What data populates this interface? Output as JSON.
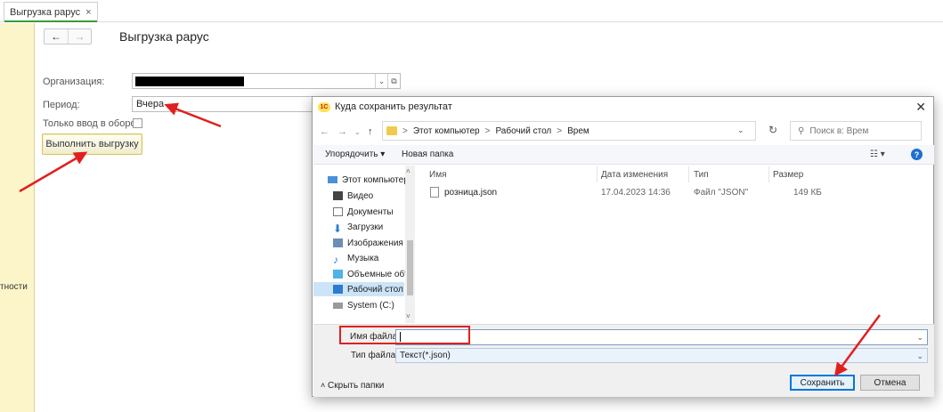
{
  "tab": {
    "label": "Выгрузка рарус",
    "close": "×"
  },
  "left_panel": {
    "text": "тности"
  },
  "form": {
    "nav_back": "←",
    "nav_forward": "→",
    "title": "Выгрузка рарус",
    "org_label": "Организация:",
    "period_label": "Период:",
    "period_value": "Вчера",
    "only_input_label": "Только ввод в оборот:",
    "run_button": "Выполнить выгрузку",
    "org_dd": "⌄",
    "org_open": "⧉"
  },
  "dialog": {
    "logo": "1С",
    "title": "Куда сохранить результат",
    "close": "✕",
    "address": {
      "crumbs": [
        "Этот компьютер",
        "Рабочий стол",
        "Врем"
      ],
      "sep": ">"
    },
    "search_placeholder": "Поиск в: Врем",
    "toolbar": {
      "organize": "Упорядочить ▾",
      "new_folder": "Новая папка",
      "view": "☷ ▾",
      "help": "?"
    },
    "nav_items": [
      {
        "label": "Этот компьютер",
        "icon": "computer-icon"
      },
      {
        "label": "Видео",
        "icon": "video-icon"
      },
      {
        "label": "Документы",
        "icon": "documents-icon"
      },
      {
        "label": "Загрузки",
        "icon": "downloads-icon"
      },
      {
        "label": "Изображения",
        "icon": "pictures-icon"
      },
      {
        "label": "Музыка",
        "icon": "music-icon"
      },
      {
        "label": "Объемные объ",
        "icon": "3d-objects-icon"
      },
      {
        "label": "Рабочий стол",
        "icon": "desktop-icon"
      },
      {
        "label": "System (C:)",
        "icon": "drive-icon"
      }
    ],
    "columns": [
      "Имя",
      "Дата изменения",
      "Тип",
      "Размер"
    ],
    "files": [
      {
        "name": "розница.json",
        "date": "17.04.2023 14:36",
        "type": "Файл \"JSON\"",
        "size": "149 КБ"
      }
    ],
    "filename_label": "Имя файла:",
    "filename_value": "",
    "filetype_label": "Тип файла:",
    "filetype_value": "Текст(*.json)",
    "hide_folders": "Скрыть папки",
    "save": "Сохранить",
    "cancel": "Отмена"
  },
  "colors": {
    "accent_yellow": "#fbf5c9",
    "tab_underline": "#3a9a3a",
    "annotation_red": "#e02020",
    "win_blue": "#0078d7"
  }
}
